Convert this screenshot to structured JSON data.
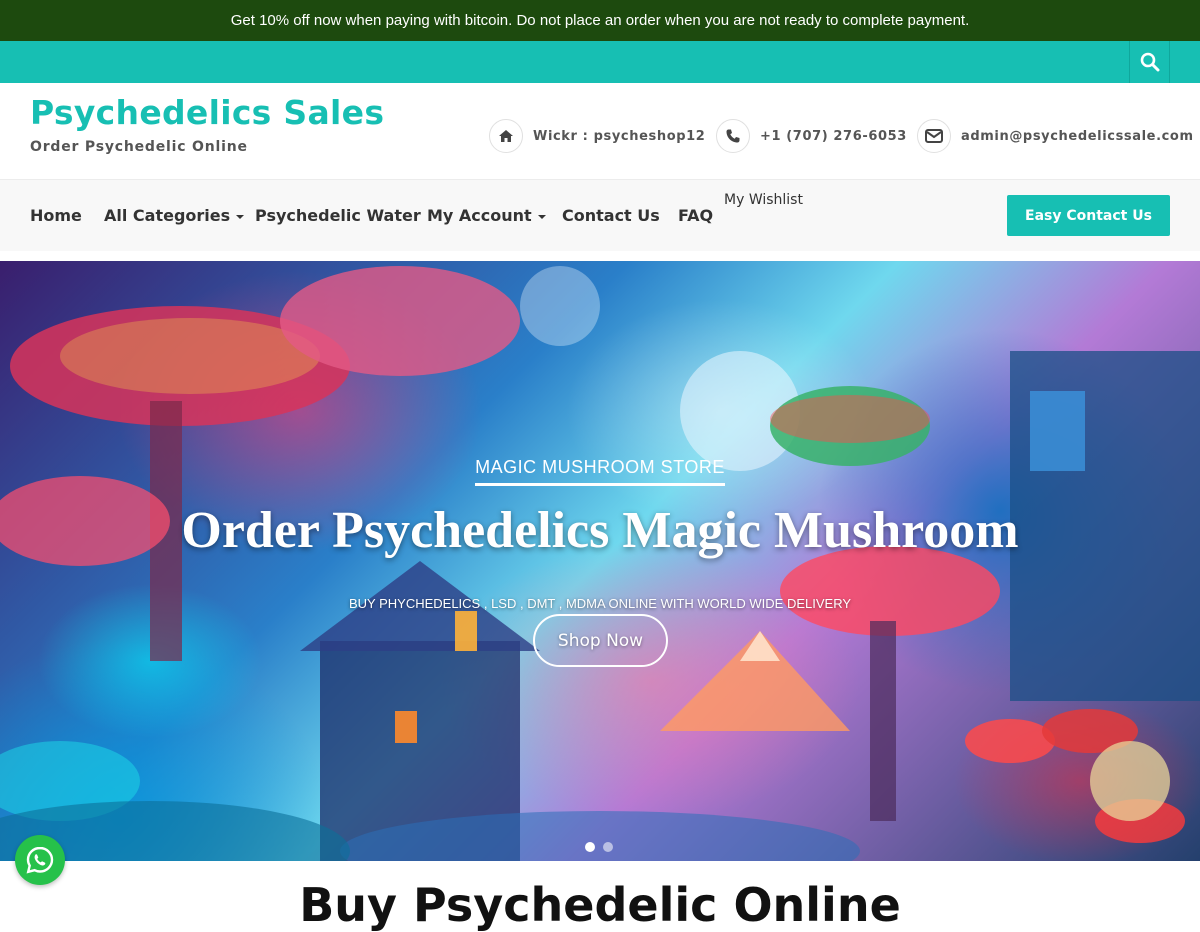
{
  "announcement": "Get 10% off now when paying with bitcoin. Do not place an order when you are not ready to complete payment.",
  "header": {
    "site_title": "Psychedelics Sales",
    "tagline": "Order Psychedelic Online",
    "contacts": [
      {
        "icon": "home-icon",
        "text": "Wickr : psycheshop12"
      },
      {
        "icon": "phone-icon",
        "text": "+1 (707) 276-6053"
      },
      {
        "icon": "envelope-icon",
        "text": "admin@psychedelicssale.com"
      }
    ]
  },
  "nav": {
    "items": [
      {
        "label": "Home"
      },
      {
        "label": "All Categories"
      },
      {
        "label": "Psychedelic Water"
      },
      {
        "label": "My Account"
      },
      {
        "label": "Contact Us"
      },
      {
        "label": "FAQ"
      }
    ],
    "wishlist": "My Wishlist",
    "cta": "Easy Contact Us"
  },
  "hero": {
    "kicker": "MAGIC MUSHROOM STORE",
    "title": "Order Psychedelics Magic Mushroom",
    "subtitle": "BUY PHYCHEDELICS , LSD , DMT , MDMA ONLINE WITH WORLD WIDE DELIVERY",
    "button": "Shop Now",
    "slides_total": 2,
    "slide_active": 1
  },
  "section_heading": "Buy Psychedelic Online",
  "colors": {
    "accent": "#17bfb3",
    "announcement_bg": "#1d4a0e",
    "whatsapp": "#26c14a"
  }
}
